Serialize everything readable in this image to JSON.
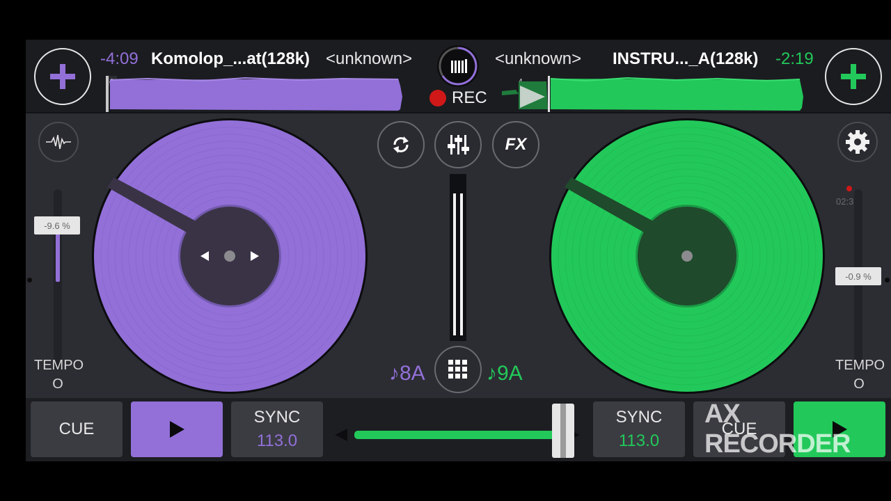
{
  "colors": {
    "deck_a": "#9270d8",
    "deck_b": "#22c95a",
    "rec": "#d01818"
  },
  "deck_a": {
    "remaining": "-4:09",
    "title": "Komolop_...at(128k)",
    "artist": "<unknown>",
    "pitch": "-9.6 %",
    "pitch_level_pct": 30,
    "tempo_label": "TEMPO",
    "key": "♪8A",
    "cue_label": "CUE",
    "sync_label": "SYNC",
    "bpm": "113.0",
    "beat_marker": "4"
  },
  "deck_b": {
    "remaining": "-2:19",
    "title": "INSTRU..._A(128k)",
    "artist": "<unknown>",
    "pitch": "-0.9 %",
    "pitch_level_pct": 3,
    "tempo_label": "TEMPO",
    "key": "♪9A",
    "cue_label": "CUE",
    "sync_label": "SYNC",
    "bpm": "113.0",
    "beat_marker": "4",
    "time_readout": "02:3"
  },
  "rec_label": "REC",
  "fx_label": "FX",
  "crossfader_position_pct": 100,
  "watermark": "AX RECORDER",
  "icons": [
    "add-track-icon",
    "library-icon",
    "waveform-icon",
    "loop-icon",
    "mixer-icon",
    "fx-icon",
    "settings-icon",
    "sampler-grid-icon",
    "play-icon",
    "rec-dot-icon"
  ]
}
